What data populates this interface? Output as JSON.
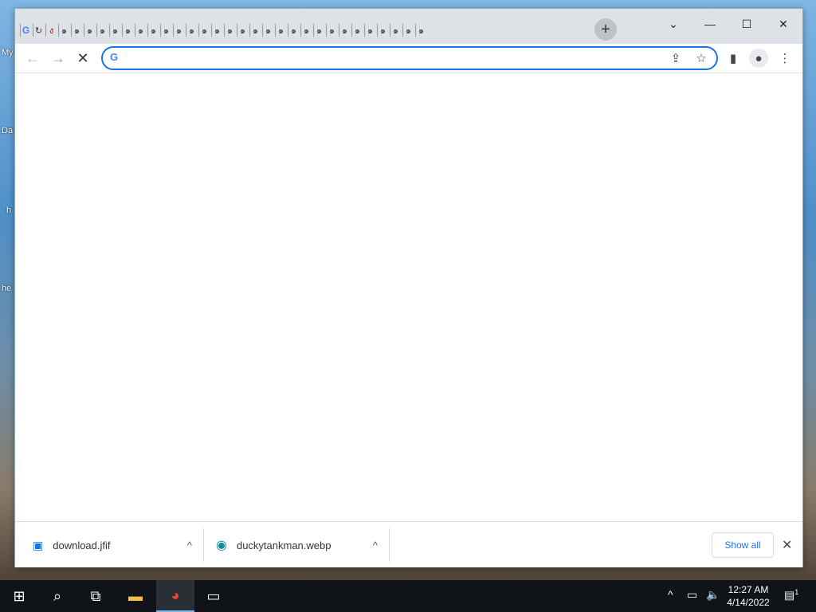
{
  "desktop": {
    "fragments": [
      "My",
      "Da",
      "h",
      "he"
    ]
  },
  "browser": {
    "tabs_count": 32,
    "new_tab_label": "+",
    "tab_search_label": "⌄",
    "minimize_label": "—",
    "maximize_label": "☐",
    "close_label": "✕",
    "omnibox": {
      "value": "",
      "placeholder": ""
    },
    "downloads": [
      {
        "name": "download.jfif",
        "icon": "image-file-icon"
      },
      {
        "name": "duckytankman.webp",
        "icon": "edge-icon"
      }
    ],
    "show_all_label": "Show all"
  },
  "taskbar": {
    "time": "12:27 AM",
    "date": "4/14/2022",
    "notification_count": "1"
  }
}
